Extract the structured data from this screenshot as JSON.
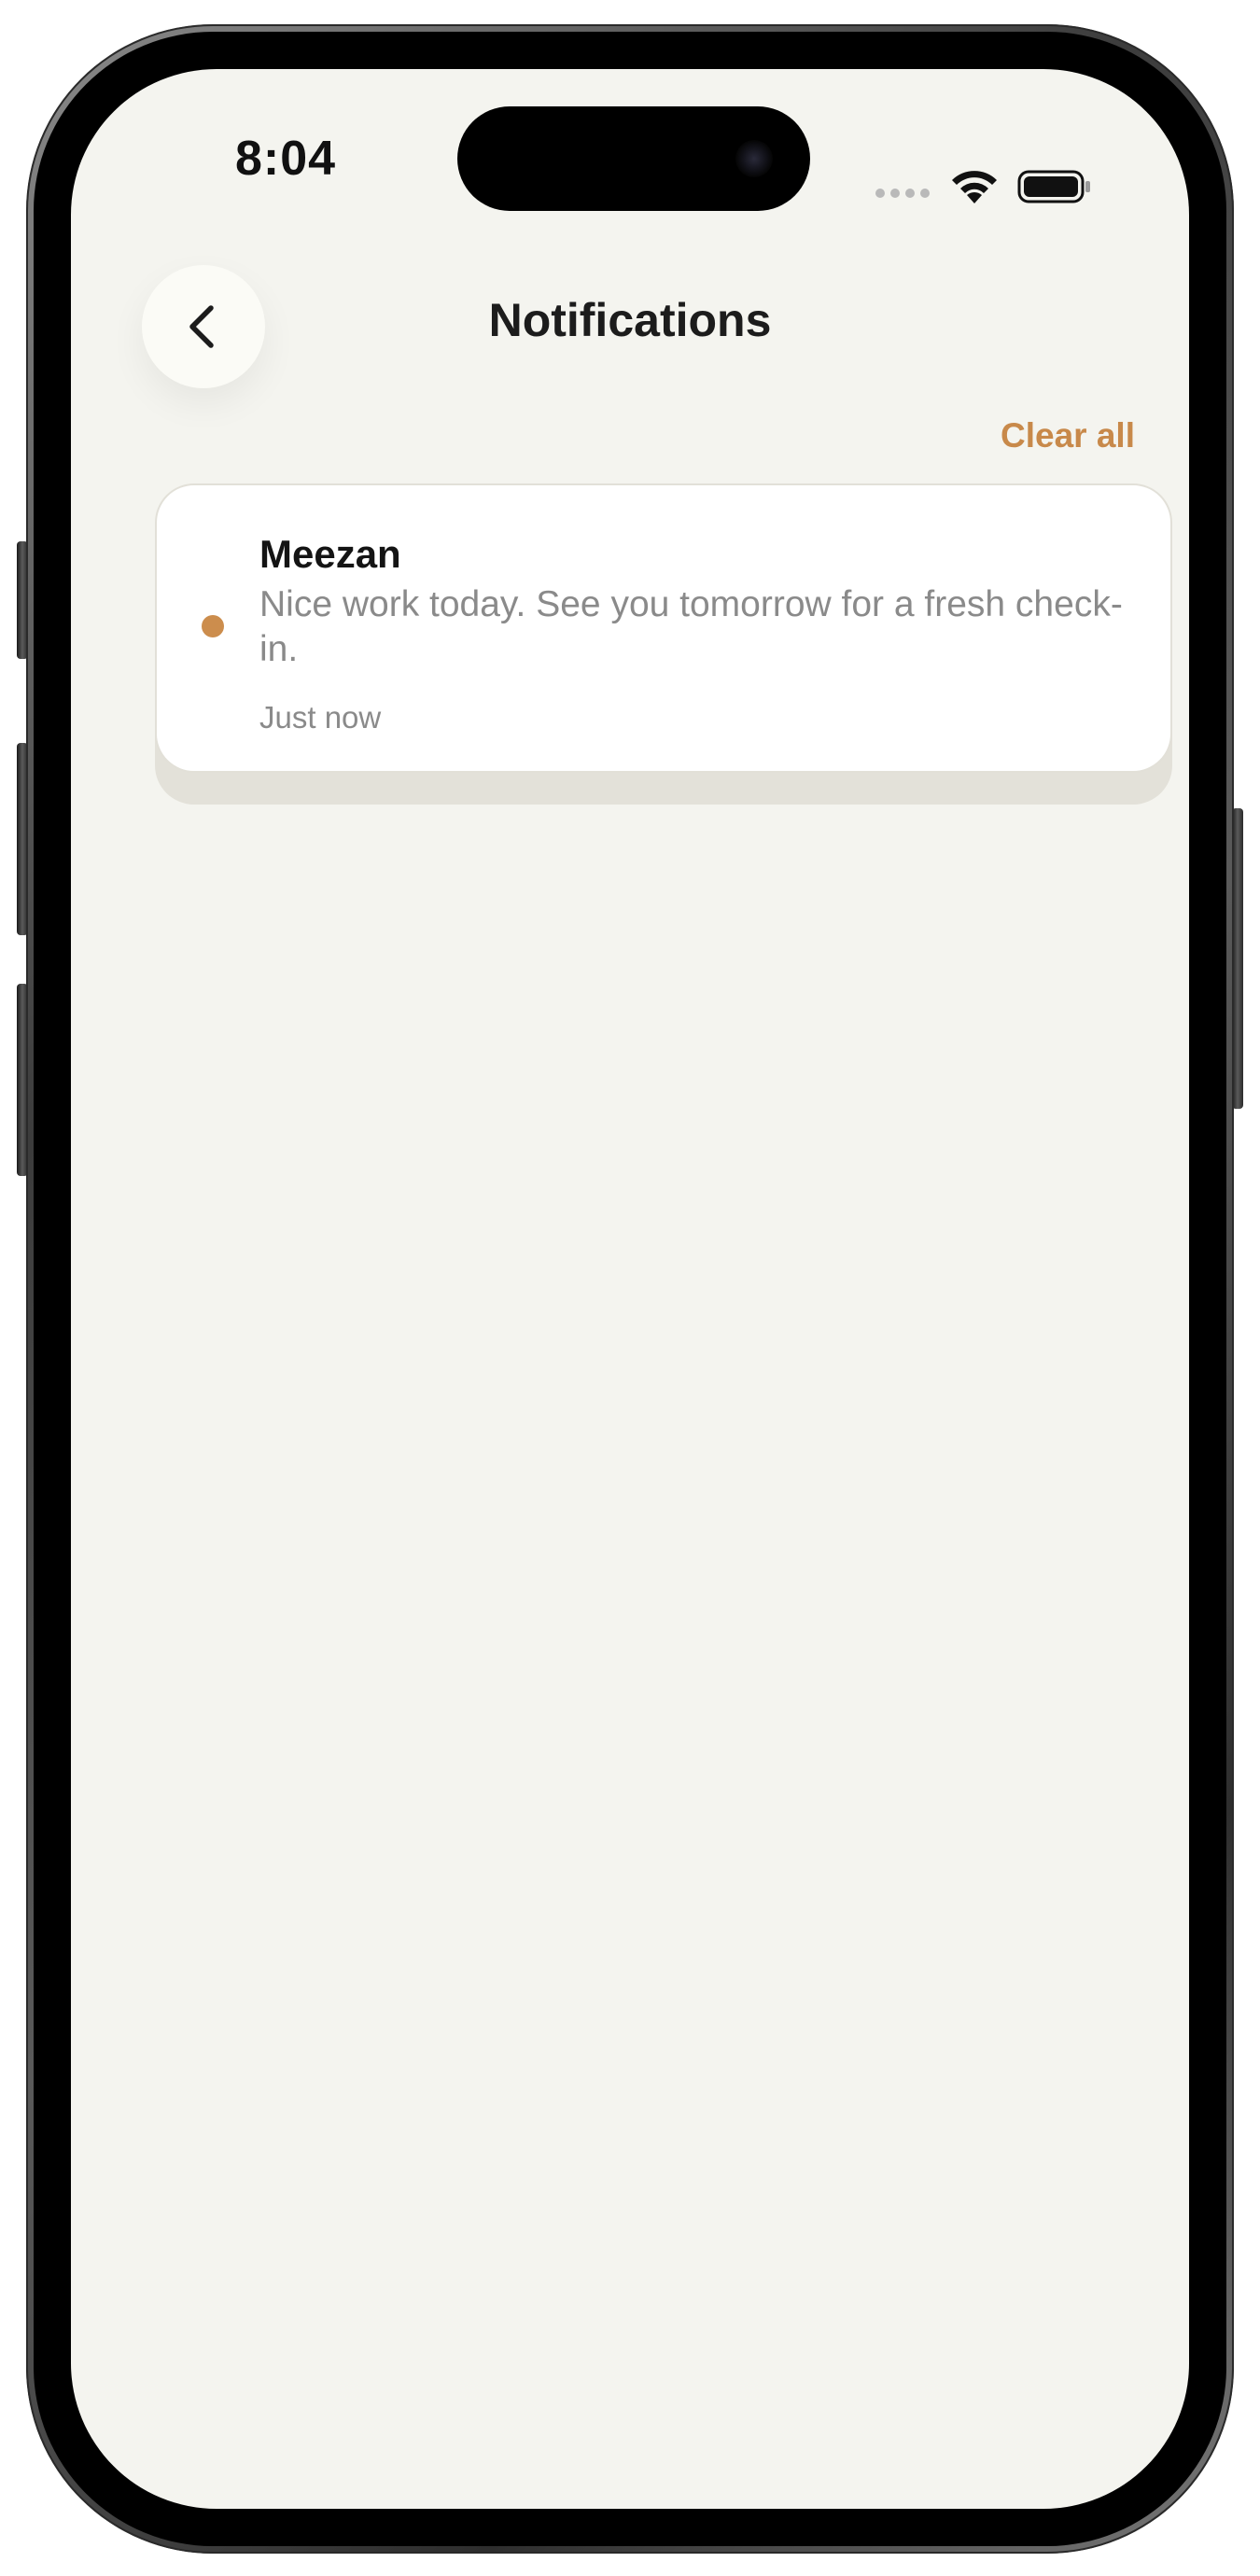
{
  "status_bar": {
    "time": "8:04"
  },
  "header": {
    "title": "Notifications",
    "back_icon": "chevron-left-icon"
  },
  "actions": {
    "clear_all_label": "Clear all"
  },
  "notifications": [
    {
      "sender": "Meezan",
      "message": "Nice work today. See you tomorrow for a fresh check-in.",
      "time": "Just now",
      "unread": true
    }
  ],
  "colors": {
    "accent": "#c8894a",
    "unread_dot": "#cc8d4d",
    "screen_background": "#f4f4ef",
    "card_background": "#ffffff"
  }
}
